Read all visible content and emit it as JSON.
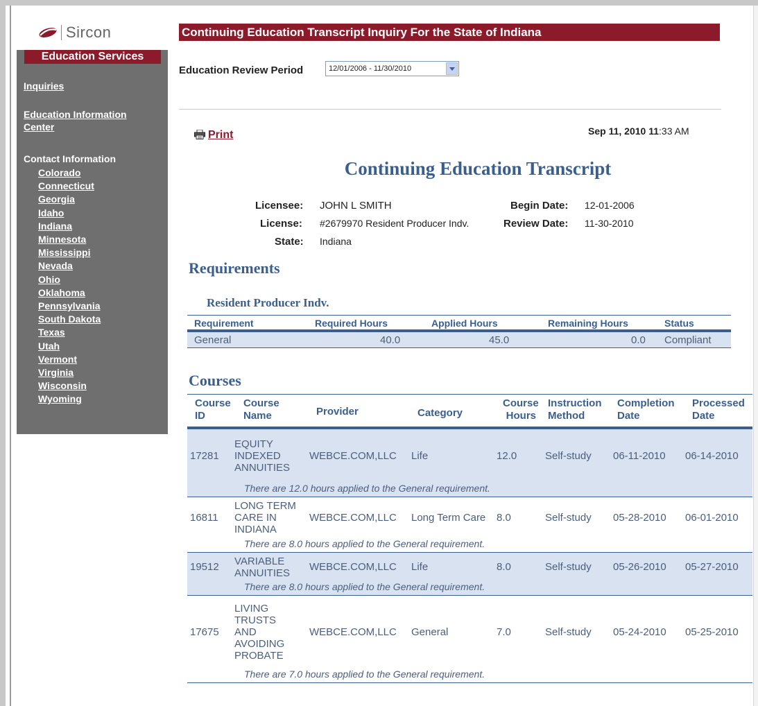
{
  "sidebar": {
    "logo_text": "Sircon",
    "header": "Education Services",
    "inquiries": "Inquiries",
    "edu_center_line1": "Education Information",
    "edu_center_line2": "Center",
    "contact_label": "Contact Information",
    "states": [
      "Colorado",
      "Connecticut",
      "Georgia",
      "Idaho",
      "Indiana",
      "Minnesota",
      "Mississippi",
      "Nevada",
      "Ohio",
      "Oklahoma",
      "Pennsylvania",
      "South Dakota",
      "Texas",
      "Utah",
      "Vermont",
      "Virginia",
      "Wisconsin",
      "Wyoming"
    ]
  },
  "header": {
    "title": "Continuing Education Transcript Inquiry For the State of Indiana"
  },
  "review": {
    "label": "Education Review Period",
    "selected": "12/01/2006 - 11/30/2010"
  },
  "print_label": "Print",
  "timestamp_pre": "Sep ",
  "timestamp_day": "11",
  "timestamp_mid": ", 2010 ",
  "timestamp_hour": "11",
  "timestamp_post": ":33 AM",
  "transcript": {
    "title": "Continuing Education Transcript",
    "licensee_label": "Licensee:",
    "licensee": "JOHN L SMITH",
    "license_label": "License:",
    "license": "#2679970 Resident Producer Indv.",
    "state_label": "State:",
    "state": "Indiana",
    "begin_label": "Begin Date:",
    "begin": "12-01-2006",
    "review_label": "Review Date:",
    "review": "11-30-2010"
  },
  "requirements": {
    "heading": "Requirements",
    "subheading": "Resident Producer Indv.",
    "columns": [
      "Requirement",
      "Required Hours",
      "Applied Hours",
      "Remaining Hours",
      "Status"
    ],
    "row": [
      "General",
      "40.0",
      "45.0",
      "0.0",
      "Compliant"
    ]
  },
  "courses": {
    "heading": "Courses",
    "columns": {
      "id1": "Course",
      "id2": "ID",
      "name1": "Course",
      "name2": "Name",
      "provider": "Provider",
      "category": "Category",
      "hours1": "Course",
      "hours2": "Hours",
      "method1": "Instruction",
      "method2": "Method",
      "completion1": "Completion",
      "completion2": "Date",
      "processed1": "Processed",
      "processed2": "Date"
    },
    "rows": [
      {
        "id": "17281",
        "name": [
          "EQUITY",
          "INDEXED",
          "ANNUITIES"
        ],
        "provider": "WEBCE.COM,LLC",
        "category": "Life",
        "hours": "12.0",
        "method": "Self-study",
        "completion": "06-11-2010",
        "processed": "06-14-2010",
        "note": "There are 12.0 hours applied to the General requirement."
      },
      {
        "id": "16811",
        "name": [
          "LONG TERM",
          "CARE IN",
          "INDIANA"
        ],
        "provider": "WEBCE.COM,LLC",
        "category": "Long Term Care",
        "hours": "8.0",
        "method": "Self-study",
        "completion": "05-28-2010",
        "processed": "06-01-2010",
        "note": "There are 8.0 hours applied to the General requirement."
      },
      {
        "id": "19512",
        "name": [
          "VARIABLE",
          "ANNUITIES"
        ],
        "provider": "WEBCE.COM,LLC",
        "category": "Life",
        "hours": "8.0",
        "method": "Self-study",
        "completion": "05-26-2010",
        "processed": "05-27-2010",
        "note": "There are 8.0 hours applied to the General requirement."
      },
      {
        "id": "17675",
        "name": [
          "LIVING",
          "TRUSTS",
          "AND",
          "AVOIDING",
          "PROBATE"
        ],
        "provider": "WEBCE.COM,LLC",
        "category": "General",
        "hours": "7.0",
        "method": "Self-study",
        "completion": "05-24-2010",
        "processed": "05-25-2010",
        "note": "There are 7.0 hours applied to the General requirement."
      }
    ]
  }
}
